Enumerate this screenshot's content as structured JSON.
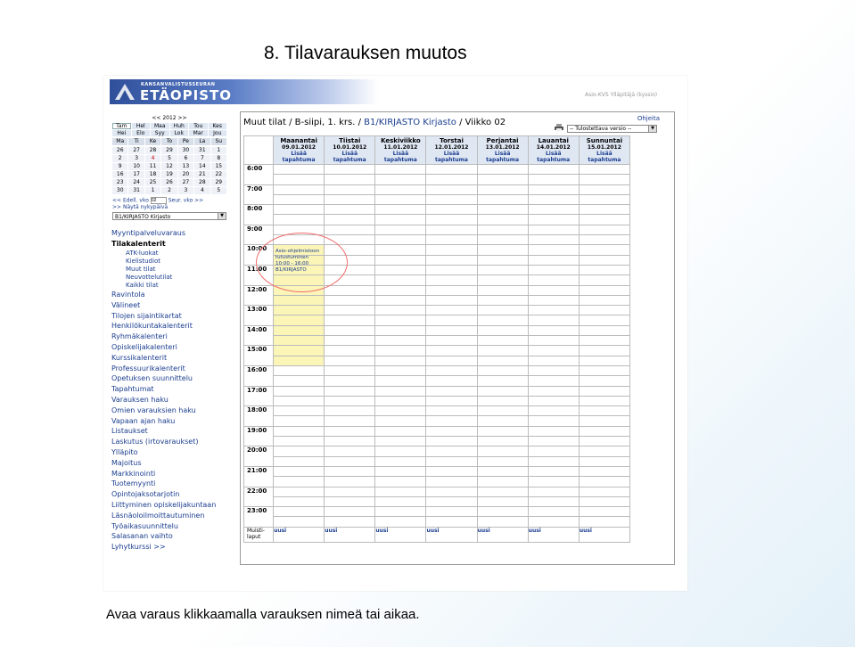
{
  "slide": {
    "title": "8. Tilavarauksen muutos",
    "caption": "Avaa varaus klikkaamalla varauksen nimeä tai aikaa."
  },
  "app": {
    "logo_top": "KANSANVALISTUSSEURAN",
    "logo_main": "ETÄOPISTO",
    "system_name": "Asio-KVS Ylläpitäjä (kyssio)"
  },
  "mini_calendar": {
    "year_nav": "<< 2012 >>",
    "months_row1": [
      "Tam",
      "Hel",
      "Maa",
      "Huh",
      "Tou",
      "Kes"
    ],
    "months_row2": [
      "Hei",
      "Elo",
      "Syy",
      "Lok",
      "Mar",
      "Jou"
    ],
    "weekdays": [
      "Ma",
      "Ti",
      "Ke",
      "To",
      "Pe",
      "La",
      "Su"
    ],
    "weeks": [
      [
        "26",
        "27",
        "28",
        "29",
        "30",
        "31",
        "1"
      ],
      [
        "2",
        "3",
        "4",
        "5",
        "6",
        "7",
        "8"
      ],
      [
        "9",
        "10",
        "11",
        "12",
        "13",
        "14",
        "15"
      ],
      [
        "16",
        "17",
        "18",
        "19",
        "20",
        "21",
        "22"
      ],
      [
        "23",
        "24",
        "25",
        "26",
        "27",
        "28",
        "29"
      ],
      [
        "30",
        "31",
        "1",
        "2",
        "3",
        "4",
        "5"
      ]
    ],
    "prev_week": "<< Edell. vko",
    "week_value": "02",
    "next_week": "Seur. vko >>",
    "show_today": ">> Näytä nykypäivä"
  },
  "resource_select": {
    "value": "B1/KIRJASTO Kirjasto"
  },
  "nav": {
    "top": "Myyntipalveluvaraus",
    "head": "Tilakalenterit",
    "sub": [
      "ATK-luokat",
      "Kielistudiot",
      "Muut tilat",
      "Neuvottelutilat",
      "Kaikki tilat"
    ],
    "items": [
      "Ravintola",
      "Välineet",
      "Tilojen sijaintikartat",
      "Henkilökuntakalenterit",
      "Ryhmäkalenteri",
      "Opiskelijakalenteri",
      "Kurssikalenterit",
      "Professuurikalenterit",
      "Opetuksen suunnittelu",
      "Tapahtumat",
      "Varauksen haku",
      "Omien varauksien haku",
      "Vapaan ajan haku",
      "Listaukset",
      "Laskutus (irtovaraukset)",
      "Ylläpito",
      "Majoitus",
      "Markkinointi",
      "Tuotemyynti",
      "Opintojaksotarjotin",
      "Liittyminen opiskelijakuntaan",
      "Läsnäoloilmoittautuminen",
      "Työaikasuunnittelu",
      "Salasanan vaihto",
      "Lyhytkurssi >>"
    ]
  },
  "main": {
    "title_prefix": "Muut tilat / B-siipi, 1. krs. / ",
    "title_resource": "B1/KIRJASTO Kirjasto",
    "title_suffix": " / Viikko 02",
    "help": "Ohjeita",
    "print_select": "-- Tulostettava versio --",
    "days": [
      {
        "name": "Maanantai",
        "date": "09.01.2012",
        "add": "Lisää tapahtuma"
      },
      {
        "name": "Tiistai",
        "date": "10.01.2012",
        "add": "Lisää tapahtuma"
      },
      {
        "name": "Keskiviikko",
        "date": "11.01.2012",
        "add": "Lisää tapahtuma"
      },
      {
        "name": "Torstai",
        "date": "12.01.2012",
        "add": "Lisää tapahtuma"
      },
      {
        "name": "Perjantai",
        "date": "13.01.2012",
        "add": "Lisää tapahtuma"
      },
      {
        "name": "Lauantai",
        "date": "14.01.2012",
        "add": "Lisää tapahtuma"
      },
      {
        "name": "Sunnuntai",
        "date": "15.01.2012",
        "add": "Lisää tapahtuma"
      }
    ],
    "hours": [
      "6:00",
      "7:00",
      "8:00",
      "9:00",
      "10:00",
      "11:00",
      "12:00",
      "13:00",
      "14:00",
      "15:00",
      "16:00",
      "17:00",
      "18:00",
      "19:00",
      "20:00",
      "21:00",
      "22:00",
      "23:00"
    ],
    "notes_label": "Muisti-laput",
    "note_link": "uusi",
    "booking": {
      "line1": "Asio-ohjelmistoon",
      "line2": "tutustuminen",
      "line3": "10:00 - 16:00",
      "line4": "B1/KIRJASTO"
    }
  },
  "colors": {
    "link": "#1a3d8f",
    "booking_bg": "#fbf5b8",
    "highlight_circle": "#f26e6e",
    "header_bg": "#dfe7f3"
  }
}
